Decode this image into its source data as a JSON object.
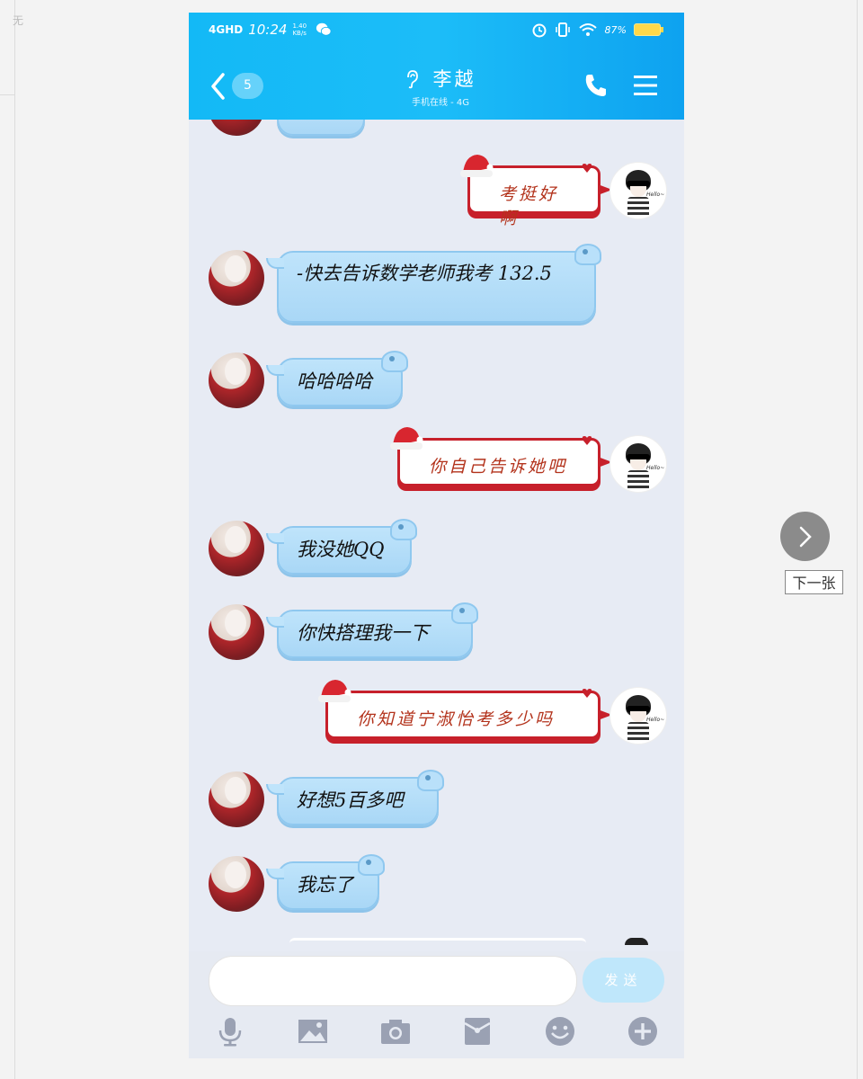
{
  "viewer": {
    "next_label": "下一张",
    "left_edge_char": "无"
  },
  "status_bar": {
    "network": "4GHD",
    "time": "10:24",
    "speed": "1.40 KB/s",
    "battery": "87%"
  },
  "header": {
    "unread_count": "5",
    "contact_name": "李越",
    "contact_status": "手机在线 - 4G"
  },
  "messages": [
    {
      "side": "right",
      "text": "考挺好啊"
    },
    {
      "side": "left",
      "text": "-快去告诉数学老师我考 132.5"
    },
    {
      "side": "left",
      "text": "哈哈哈哈"
    },
    {
      "side": "right",
      "text": "你自己告诉她吧"
    },
    {
      "side": "left",
      "text": "我没她QQ"
    },
    {
      "side": "left",
      "text": "你快搭理我一下"
    },
    {
      "side": "right",
      "text": "你知道宁淑怡考多少吗"
    },
    {
      "side": "left",
      "text": "好想5百多吧"
    },
    {
      "side": "left",
      "text": "我忘了"
    }
  ],
  "composer": {
    "input_value": "",
    "send_label": "发送"
  },
  "icons": {
    "toolbar": [
      "microphone-icon",
      "image-icon",
      "camera-icon",
      "red-packet-icon",
      "emoji-icon",
      "plus-icon"
    ]
  },
  "colors": {
    "header_blue": "#13b9f6",
    "chat_bg": "#e7ebf4",
    "left_bubble": "#bfe4fb",
    "right_bubble_border": "#c7202b"
  }
}
